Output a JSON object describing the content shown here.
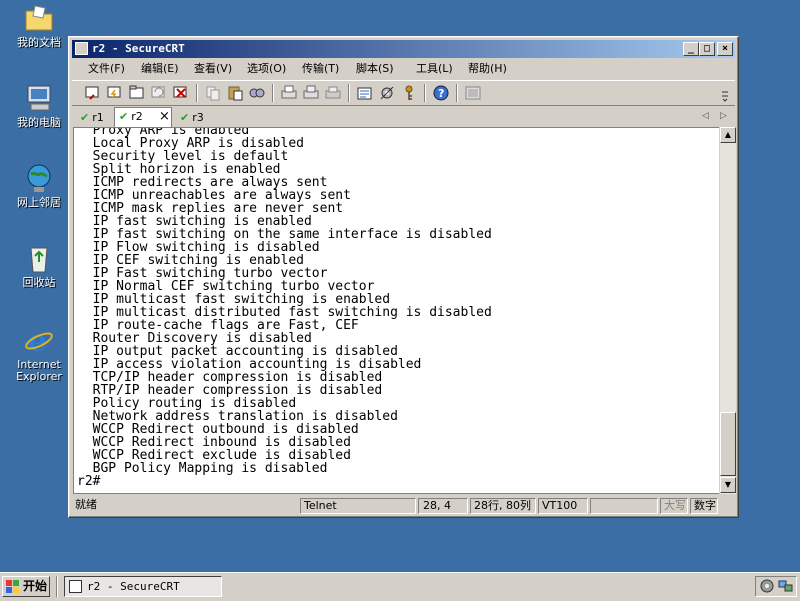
{
  "desktop": {
    "icons": [
      {
        "label": "我的文档"
      },
      {
        "label": "我的电脑"
      },
      {
        "label": "网上邻居"
      },
      {
        "label": "回收站"
      },
      {
        "label": "Internet Explorer"
      }
    ]
  },
  "window": {
    "title": "r2 - SecureCRT",
    "menus": [
      "文件(F)",
      "编辑(E)",
      "查看(V)",
      "选项(O)",
      "传输(T)",
      "脚本(S)",
      "工具(L)",
      "帮助(H)"
    ],
    "tabs": [
      {
        "label": "r1",
        "active": false
      },
      {
        "label": "r2",
        "active": true
      },
      {
        "label": "r3",
        "active": false
      }
    ],
    "tab_close": "×",
    "terminal_lines": [
      "  Proxy ARP is enabled",
      "  Local Proxy ARP is disabled",
      "  Security level is default",
      "  Split horizon is enabled",
      "  ICMP redirects are always sent",
      "  ICMP unreachables are always sent",
      "  ICMP mask replies are never sent",
      "  IP fast switching is enabled",
      "  IP fast switching on the same interface is disabled",
      "  IP Flow switching is disabled",
      "  IP CEF switching is enabled",
      "  IP Fast switching turbo vector",
      "  IP Normal CEF switching turbo vector",
      "  IP multicast fast switching is enabled",
      "  IP multicast distributed fast switching is disabled",
      "  IP route-cache flags are Fast, CEF",
      "  Router Discovery is disabled",
      "  IP output packet accounting is disabled",
      "  IP access violation accounting is disabled",
      "  TCP/IP header compression is disabled",
      "  RTP/IP header compression is disabled",
      "  Policy routing is disabled",
      "  Network address translation is disabled",
      "  WCCP Redirect outbound is disabled",
      "  WCCP Redirect inbound is disabled",
      "  WCCP Redirect exclude is disabled",
      "  BGP Policy Mapping is disabled",
      "r2#"
    ],
    "status": {
      "ready": "就绪",
      "protocol": "Telnet",
      "cursor": "28,  4",
      "size": "28行, 80列",
      "emulation": "VT100",
      "caps": "大写",
      "num": "数字"
    }
  },
  "taskbar": {
    "start_label": "开始",
    "task_label": "r2 - SecureCRT"
  }
}
